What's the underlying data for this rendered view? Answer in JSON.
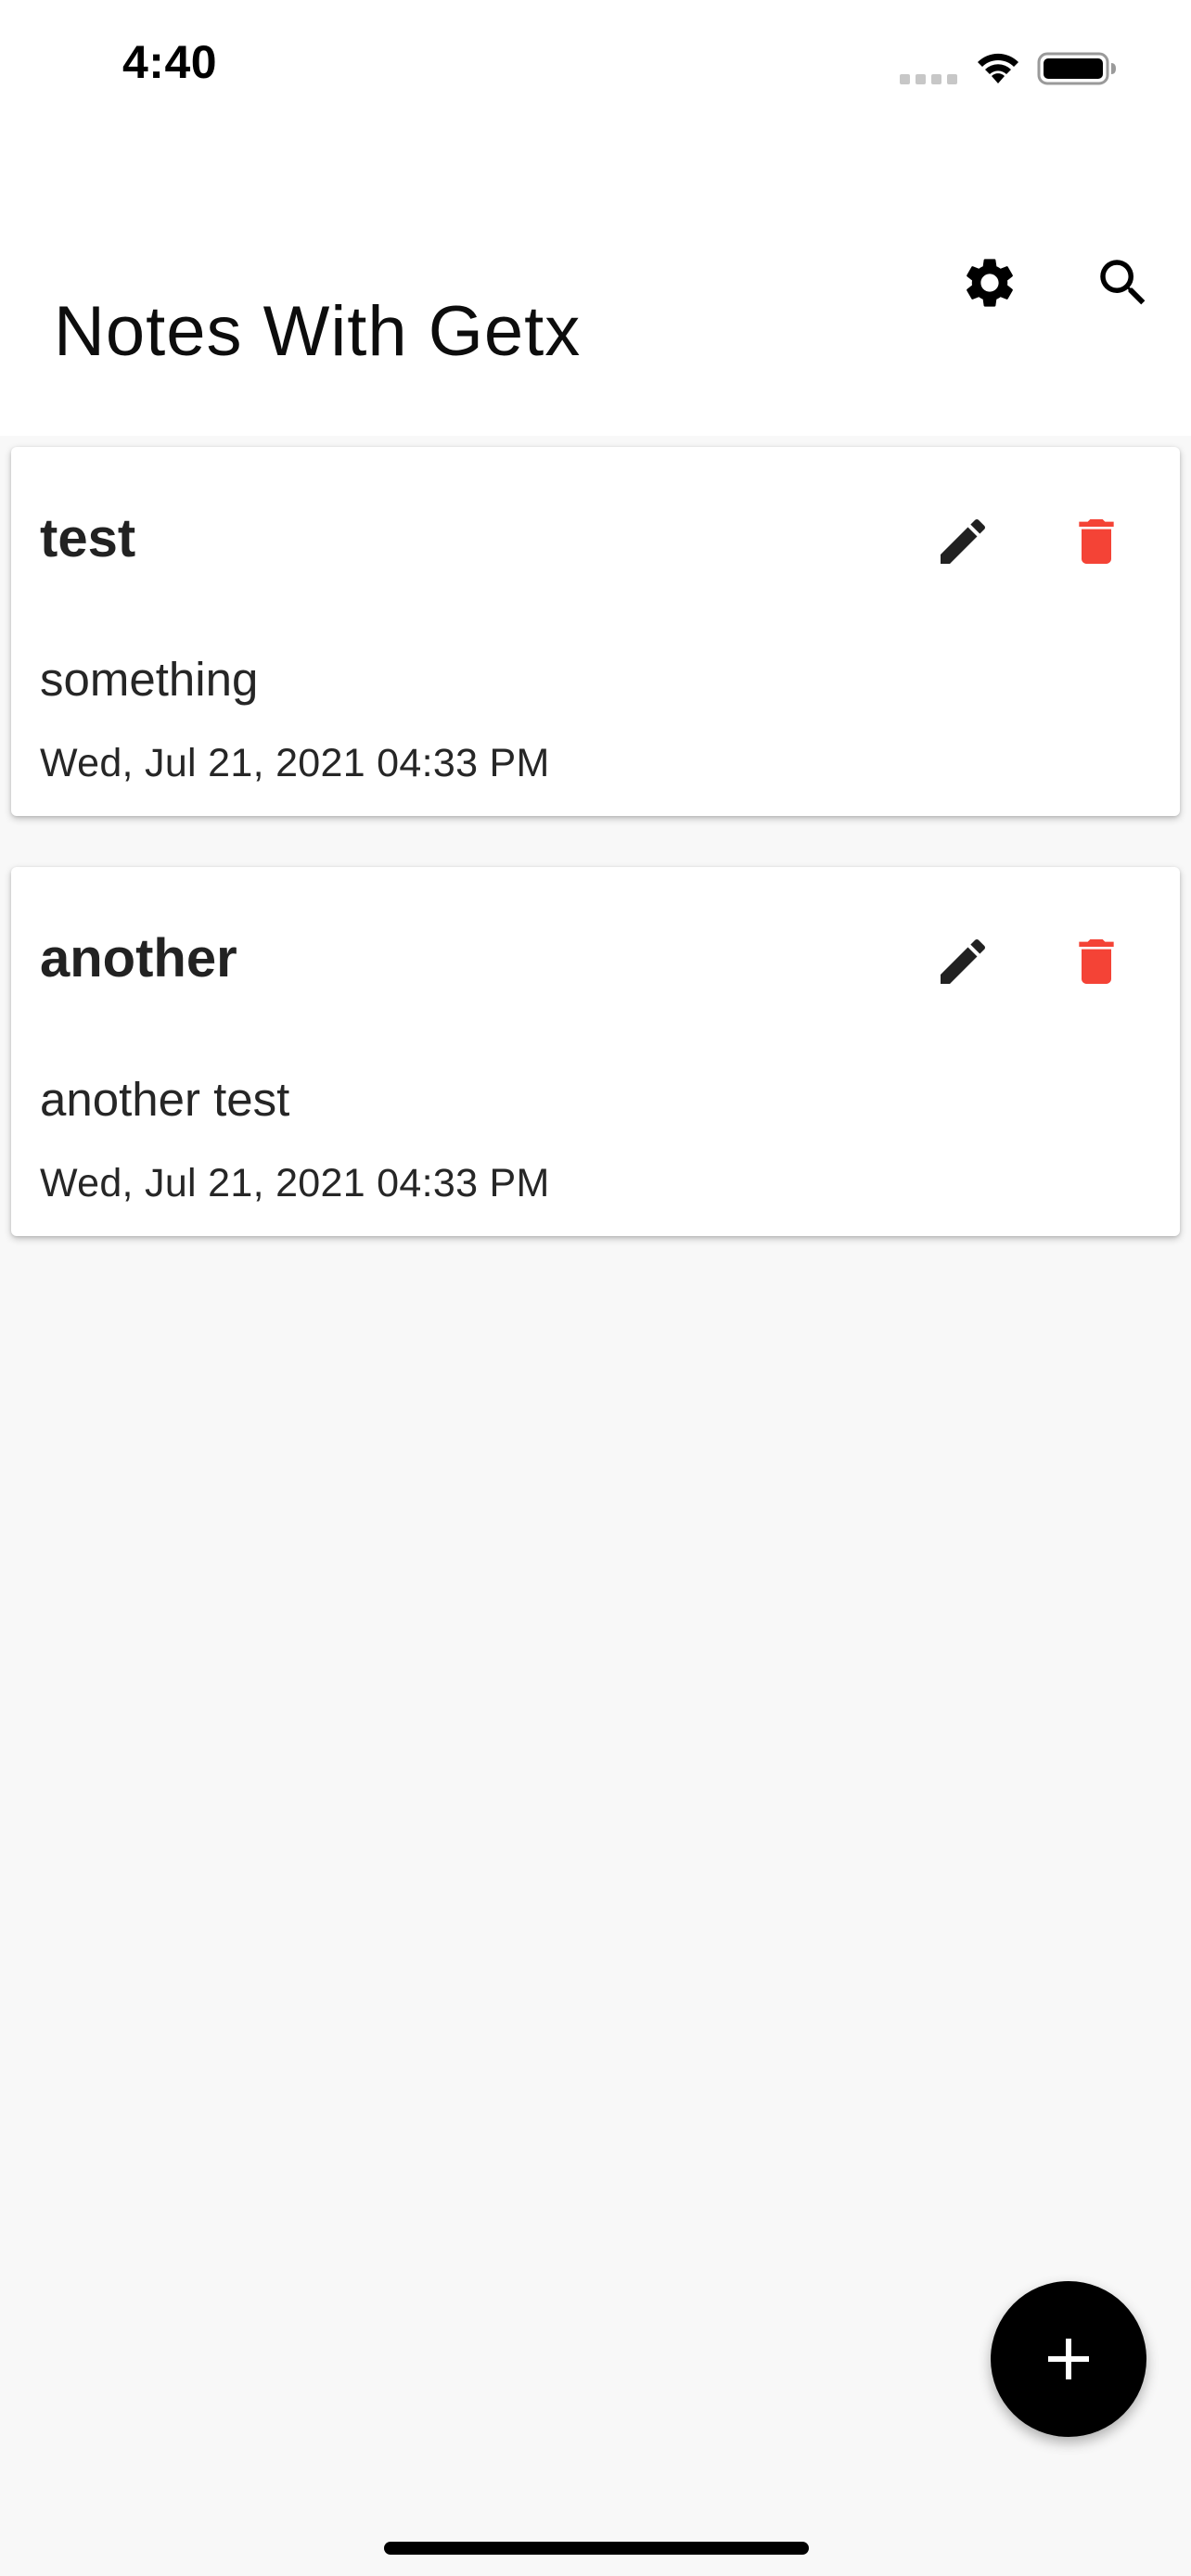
{
  "status_bar": {
    "time": "4:40",
    "signal_icon": "cellular-signal-icon",
    "wifi_icon": "wifi-icon",
    "battery_icon": "battery-icon"
  },
  "app_bar": {
    "title": "Notes With Getx",
    "actions": [
      {
        "icon": "gear-icon",
        "name": "settings"
      },
      {
        "icon": "search-icon",
        "name": "search"
      }
    ]
  },
  "notes": [
    {
      "title": "test",
      "body": "something",
      "date": "Wed, Jul 21, 2021 04:33 PM"
    },
    {
      "title": "another",
      "body": "another test",
      "date": "Wed, Jul 21, 2021 04:33 PM"
    }
  ],
  "note_actions": {
    "edit_icon": "pencil-icon",
    "delete_icon": "trash-icon"
  },
  "fab": {
    "icon": "plus-icon"
  },
  "colors": {
    "background": "#f8f8f8",
    "card": "#ffffff",
    "delete_red": "#f44336",
    "icon_dark": "#212121",
    "fab": "#000000"
  }
}
